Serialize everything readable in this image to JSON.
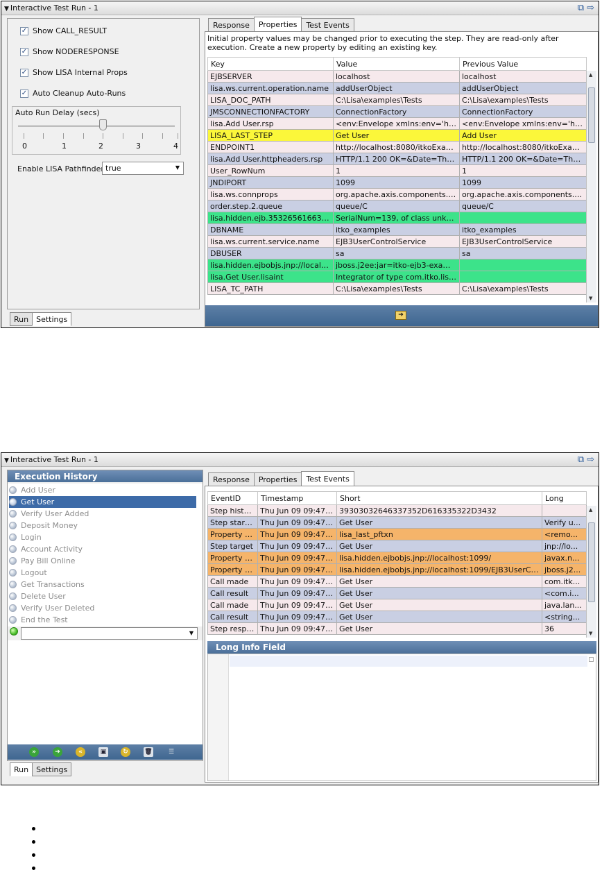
{
  "colors": {
    "row_pink": "#f6e9ec",
    "row_blue": "#c9cfe3",
    "row_yellow": "#fbf73a",
    "row_green": "#3ce38a",
    "row_orange": "#f5b46a",
    "accent_bar": "#4b6f99"
  },
  "screen1": {
    "window_title": "Interactive Test Run - 1",
    "checkboxes": [
      {
        "label": "Show CALL_RESULT",
        "checked": true
      },
      {
        "label": "Show NODERESPONSE",
        "checked": true
      },
      {
        "label": "Show LISA Internal Props",
        "checked": true
      },
      {
        "label": "Auto Cleanup Auto-Runs",
        "checked": true
      }
    ],
    "delay": {
      "label": "Auto Run Delay (secs)",
      "ticks": [
        "0",
        "1",
        "2",
        "3",
        "4"
      ],
      "value": 2
    },
    "pathfinder": {
      "label": "Enable LISA Pathfinder",
      "value": "true"
    },
    "bottom_tabs": [
      "Run",
      "Settings"
    ],
    "tabs": [
      "Response",
      "Properties",
      "Test Events"
    ],
    "info_text": "Initial property values may be changed prior to executing the step. They are read-only after execution. Create a new property by editing an existing key.",
    "columns": [
      "Key",
      "Value",
      "Previous Value"
    ],
    "rows": [
      {
        "key": "EJBSERVER",
        "value": "localhost",
        "prev": "localhost",
        "color": "pink"
      },
      {
        "key": "lisa.ws.current.operation.name",
        "value": "addUserObject",
        "prev": "addUserObject",
        "color": "blue"
      },
      {
        "key": "LISA_DOC_PATH",
        "value": "C:\\Lisa\\examples\\Tests",
        "prev": "C:\\Lisa\\examples\\Tests",
        "color": "pink"
      },
      {
        "key": "JMSCONNECTIONFACTORY",
        "value": "ConnectionFactory",
        "prev": "ConnectionFactory",
        "color": "blue"
      },
      {
        "key": "lisa.Add User.rsp",
        "value": "<env:Envelope xmlns:env='htt...",
        "prev": "<env:Envelope xmlns:env='htt...",
        "color": "pink"
      },
      {
        "key": "LISA_LAST_STEP",
        "value": "Get User",
        "prev": "Add User",
        "color": "yellow"
      },
      {
        "key": "ENDPOINT1",
        "value": "http://localhost:8080/itkoExamp...",
        "prev": "http://localhost:8080/itkoExam...",
        "color": "pink"
      },
      {
        "key": "lisa.Add User.httpheaders.rsp",
        "value": "HTTP/1.1 200 OK=&Date=Thu, ...",
        "prev": "HTTP/1.1 200 OK=&Date=Thu, ...",
        "color": "blue"
      },
      {
        "key": "User_RowNum",
        "value": "1",
        "prev": "1",
        "color": "pink"
      },
      {
        "key": "JNDIPORT",
        "value": "1099",
        "prev": "1099",
        "color": "blue"
      },
      {
        "key": "lisa.ws.connprops",
        "value": "org.apache.axis.components.n...",
        "prev": "org.apache.axis.components.n...",
        "color": "pink"
      },
      {
        "key": "order.step.2.queue",
        "value": "queue/C",
        "prev": "queue/C",
        "color": "blue"
      },
      {
        "key": "lisa.hidden.ejb.3532656166333...",
        "value": " SerialNum=139, of class unkno...",
        "prev": "",
        "color": "green"
      },
      {
        "key": "DBNAME",
        "value": "itko_examples",
        "prev": "itko_examples",
        "color": "blue"
      },
      {
        "key": "lisa.ws.current.service.name",
        "value": "EJB3UserControlService",
        "prev": "EJB3UserControlService",
        "color": "pink"
      },
      {
        "key": "DBUSER",
        "value": "sa",
        "prev": "sa",
        "color": "blue"
      },
      {
        "key": "lisa.hidden.ejbobjs.jnp://localho...",
        "value": "jboss.j2ee:jar=itko-ejb3-exampl...",
        "prev": "",
        "color": "green"
      },
      {
        "key": "lisa.Get User.lisaint",
        "value": "Integrator of type com.itko.lisai...",
        "prev": "",
        "color": "green"
      },
      {
        "key": "LISA_TC_PATH",
        "value": "C:\\Lisa\\examples\\Tests",
        "prev": "C:\\Lisa\\examples\\Tests",
        "color": "pink"
      }
    ]
  },
  "screen2": {
    "window_title": "Interactive Test Run - 1",
    "history_title": "Execution History",
    "history": [
      {
        "label": "Add User",
        "selected": false
      },
      {
        "label": "Get User",
        "selected": true
      },
      {
        "label": "Verify User Added",
        "selected": false
      },
      {
        "label": "Deposit Money",
        "selected": false
      },
      {
        "label": "Login",
        "selected": false
      },
      {
        "label": "Account Activity",
        "selected": false
      },
      {
        "label": "Pay Bill Online",
        "selected": false
      },
      {
        "label": "Logout",
        "selected": false
      },
      {
        "label": "Get Transactions",
        "selected": false
      },
      {
        "label": "Delete User",
        "selected": false
      },
      {
        "label": "Verify User Deleted",
        "selected": false
      },
      {
        "label": "End the Test",
        "selected": false
      }
    ],
    "bottom_tabs": [
      "Run",
      "Settings"
    ],
    "tabs": [
      "Response",
      "Properties",
      "Test Events"
    ],
    "columns": [
      "EventID",
      "Timestamp",
      "Short",
      "Long"
    ],
    "rows": [
      {
        "event": "Step history",
        "ts": "Thu Jun 09 09:47:...",
        "short": "39303032646337352D616335322D3432",
        "long": "",
        "color": "pink"
      },
      {
        "event": "Step started",
        "ts": "Thu Jun 09 09:47:...",
        "short": "Get User",
        "long": "Verify u...",
        "color": "blue"
      },
      {
        "event": "Property set",
        "ts": "Thu Jun 09 09:47:...",
        "short": "lisa_last_pftxn",
        "long": "<remo...",
        "color": "orange"
      },
      {
        "event": "Step target",
        "ts": "Thu Jun 09 09:47:...",
        "short": "Get User",
        "long": "jnp://lo...",
        "color": "blue"
      },
      {
        "event": "Property set",
        "ts": "Thu Jun 09 09:47:...",
        "short": "lisa.hidden.ejbobjs.jnp://localhost:1099/",
        "long": "javax.n...",
        "color": "orange"
      },
      {
        "event": "Property set",
        "ts": "Thu Jun 09 09:47:...",
        "short": "lisa.hidden.ejbobjs.jnp://localhost:1099/EJB3UserCon...",
        "long": "jboss.j2...",
        "color": "orange"
      },
      {
        "event": "Call made",
        "ts": "Thu Jun 09 09:47:...",
        "short": "Get User",
        "long": "com.itk...",
        "color": "pink"
      },
      {
        "event": "Call result",
        "ts": "Thu Jun 09 09:47:...",
        "short": "Get User",
        "long": "<com.i...",
        "color": "blue"
      },
      {
        "event": "Call made",
        "ts": "Thu Jun 09 09:47:...",
        "short": "Get User",
        "long": "java.lan...",
        "color": "pink"
      },
      {
        "event": "Call result",
        "ts": "Thu Jun 09 09:47:...",
        "short": "Get User",
        "long": "<string...",
        "color": "blue"
      },
      {
        "event": "Step respo...",
        "ts": "Thu Jun 09 09:47:...",
        "short": "Get User",
        "long": "36",
        "color": "pink"
      }
    ],
    "long_info_title": "Long Info Field"
  },
  "bullets": [
    "",
    "",
    "",
    ""
  ]
}
